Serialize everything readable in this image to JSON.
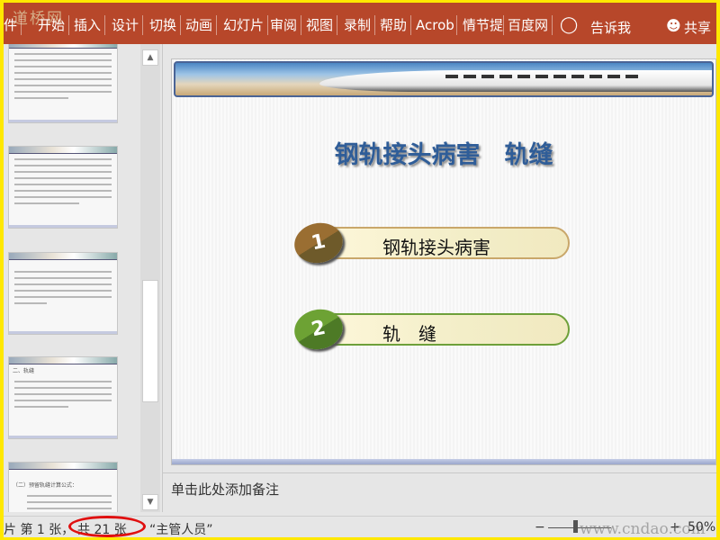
{
  "ribbon": {
    "watermark": "道桥网",
    "tabs": [
      "件",
      "开始",
      "插入",
      "设计",
      "切换",
      "动画",
      "幻灯片",
      "审阅",
      "视图",
      "录制",
      "帮助",
      "Acrob",
      "情节提",
      "百度网"
    ],
    "tell_me": "告诉我",
    "share": "共享",
    "bg_color": "#b7472a"
  },
  "thumbnails": [
    {
      "title": ""
    },
    {
      "title": ""
    },
    {
      "title": ""
    },
    {
      "title": "二、轨缝"
    },
    {
      "title": "（二）预留轨缝计算公式："
    }
  ],
  "slide": {
    "title": "钢轨接头病害　轨缝",
    "items": [
      {
        "num": "1",
        "label": "钢轨接头病害",
        "color": "#8b6a2e"
      },
      {
        "num": "2",
        "label": "轨　缝",
        "color": "#5b8a2a"
      }
    ]
  },
  "notes": {
    "placeholder": "单击此处添加备注"
  },
  "status": {
    "slide_prefix": "片 第 1 张，",
    "slide_total": "共 21 张",
    "theme": "“主管人员”",
    "zoom": "50%",
    "zoom_minus": "−",
    "zoom_plus": "+",
    "watermark": "www.cndao.com"
  }
}
